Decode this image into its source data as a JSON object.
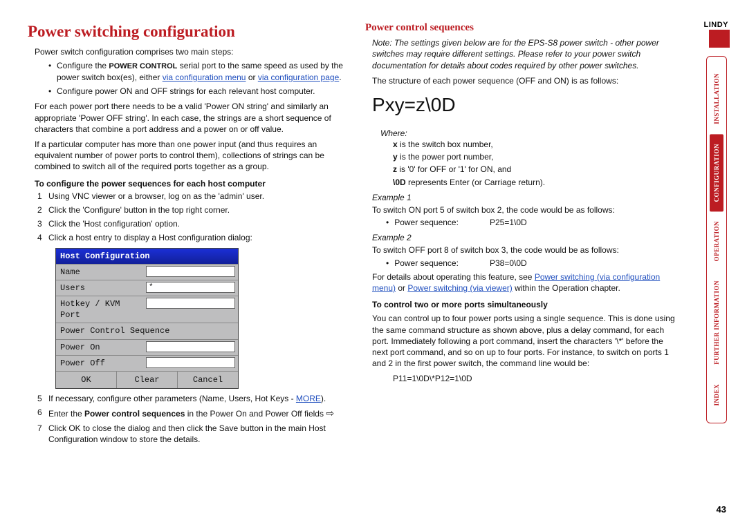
{
  "page_number": "43",
  "logo": "LINDY",
  "nav": [
    "INSTALLATION",
    "CONFIGURATION",
    "OPERATION",
    "FURTHER INFORMATION",
    "INDEX"
  ],
  "nav_active_index": 1,
  "left": {
    "h1": "Power switching configuration",
    "intro": "Power switch configuration comprises two main steps:",
    "b1a": "Configure the ",
    "b1b": "POWER CONTROL",
    "b1c": " serial port to the same speed as used by the power switch box(es), either ",
    "b1_link1": "via configuration menu",
    "b1_or": " or ",
    "b1_link2": "via configuration page",
    "b1d": ".",
    "b2": "Configure power ON and OFF strings for each relevant host computer.",
    "p1": "For each power port there needs to be a valid 'Power ON string' and similarly an appropriate 'Power OFF string'. In each case, the strings are a short sequence of characters that combine a port address and a power on or off value.",
    "p2": "If a particular computer has more than one power input (and thus requires an equivalent number of power ports to control them), collections of strings can be combined to switch all of the required ports together as a group.",
    "steps_h": "To configure the power sequences for each host computer",
    "s1": "Using VNC viewer or a browser, log on as the 'admin' user.",
    "s2": "Click the 'Configure' button in the top right corner.",
    "s3": "Click the 'Host configuration' option.",
    "s4": "Click a host entry to display a Host configuration dialog:",
    "s5a": "If necessary, configure other parameters (Name, Users, Hot Keys - ",
    "s5_link": "MORE",
    "s5b": ").",
    "s6a": "Enter the ",
    "s6b": "Power control sequences",
    "s6c": " in the Power On and Power Off fields ",
    "s7": "Click OK to close the dialog and then click the Save button in the main Host Configuration window to store the details.",
    "dialog": {
      "title": "Host Configuration",
      "r1": "Name",
      "r2": "Users",
      "r2_val": "*",
      "r3": "Hotkey / KVM Port",
      "r4": "Power Control Sequence",
      "r5": "Power On",
      "r6": "Power Off",
      "btn1": "OK",
      "btn2": "Clear",
      "btn3": "Cancel"
    }
  },
  "right": {
    "h2": "Power control sequences",
    "note": "Note: The settings given below are for the EPS-S8 power switch - other power switches may require different settings. Please refer to your power switch documentation for details about codes required by other power switches.",
    "p1": "The structure of each power sequence (OFF and ON) is as follows:",
    "formula": "Pxy=z\\0D",
    "where": "Where:",
    "w1a": "x",
    "w1b": " is the switch box number,",
    "w2a": "y",
    "w2b": " is the power port number,",
    "w3a": "z",
    "w3b": " is '0' for OFF or '1' for ON, and",
    "w4a": "\\0D",
    "w4b": " represents Enter (or Carriage return).",
    "ex1": "Example 1",
    "ex1t": "To switch ON port 5 of switch box 2, the code would be as follows:",
    "ex1lbl": "Power sequence:",
    "ex1val": "P25=1\\0D",
    "ex2": "Example 2",
    "ex2t": "To switch OFF port 8 of switch box 3, the code would be as follows:",
    "ex2lbl": "Power sequence:",
    "ex2val": "P38=0\\0D",
    "p2a": "For details about operating this feature, see ",
    "p2_link1": "Power switching (via configuration menu)",
    "p2_or": " or ",
    "p2_link2": "Power switching (via viewer)",
    "p2b": " within the Operation chapter.",
    "h3": "To control two or more ports simultaneously",
    "p3": "You can control up to four power ports using a single sequence. This is done using the same command structure as shown above, plus a delay command, for each port. Immediately following a port command, insert the characters '\\*' before the next port command, and so on up to four ports. For instance, to switch on ports 1 and 2 in the first power switch, the command line would be:",
    "p3code": "P11=1\\0D\\*P12=1\\0D"
  }
}
